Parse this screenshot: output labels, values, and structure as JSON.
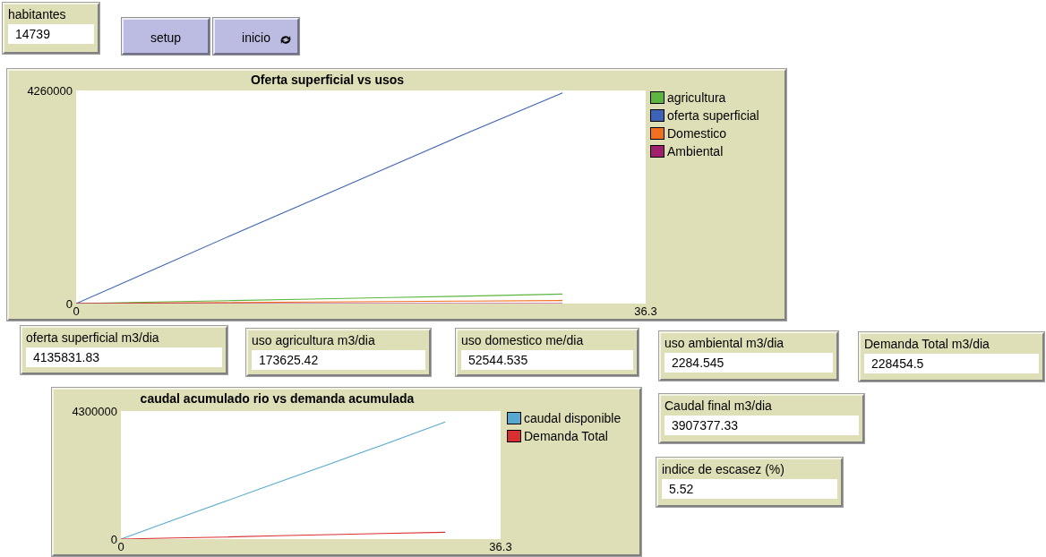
{
  "habitantes": {
    "label": "habitantes",
    "value": "14739"
  },
  "buttons": [
    {
      "label": "setup",
      "kind": "once"
    },
    {
      "label": "inicio",
      "kind": "forever"
    }
  ],
  "plots": [
    {
      "chart_data": {
        "type": "line",
        "title": "Oferta superficial vs usos",
        "x": [
          0,
          5,
          10,
          15,
          20,
          25,
          31
        ],
        "xlim": [
          0,
          36.3
        ],
        "ylim": [
          0,
          4260000
        ],
        "xticks": [
          {
            "value": 0,
            "label": "0"
          },
          36.3
        ],
        "yticks": [
          {
            "value": 0,
            "label": "0"
          },
          4260000
        ],
        "series": [
          {
            "name": "agricultura",
            "color": "#5cb53f",
            "values": [
              0,
              30000,
              60000,
              90000,
              120000,
              150000,
              190000
            ]
          },
          {
            "name": "oferta superficial",
            "color": "#3c63b5",
            "values": [
              0,
              690000,
              1380000,
              2060000,
              2740000,
              3420000,
              4210000
            ]
          },
          {
            "name": "Domestico",
            "color": "#f07020",
            "values": [
              0,
              10000,
              20000,
              30000,
              40000,
              50000,
              60000
            ]
          },
          {
            "name": "Ambiental",
            "color": "#a0206e",
            "values": [
              0,
              0,
              0,
              0,
              0,
              0,
              0
            ]
          }
        ]
      }
    },
    {
      "chart_data": {
        "type": "line",
        "title": "caudal acumulado rio vs demanda acumulada",
        "x": [
          0,
          5,
          10,
          15,
          20,
          25,
          31
        ],
        "xlim": [
          0,
          36.3
        ],
        "ylim": [
          0,
          4300000
        ],
        "xticks": [
          {
            "value": 0,
            "label": "0"
          },
          36.3
        ],
        "yticks": [
          {
            "value": 0,
            "label": "0"
          },
          4300000
        ],
        "series": [
          {
            "name": "caudal disponible",
            "color": "#56a8d0",
            "values": [
              0,
              640000,
              1270000,
              1900000,
              2530000,
              3160000,
              3930000
            ]
          },
          {
            "name": "Demanda Total",
            "color": "#d83030",
            "values": [
              0,
              40000,
              70000,
              110000,
              150000,
              190000,
              230000
            ]
          }
        ]
      }
    }
  ],
  "monitors": [
    {
      "label": "oferta superficial m3/dia",
      "value": "4135831.83"
    },
    {
      "label": "uso agricultura m3/dia",
      "value": "173625.42"
    },
    {
      "label": "uso domestico me/dia",
      "value": "52544.535"
    },
    {
      "label": "uso ambiental m3/dia",
      "value": "2284.545"
    },
    {
      "label": "Demanda Total m3/dia",
      "value": "228454.5"
    },
    {
      "label": "Caudal final m3/dia",
      "value": "3907377.33"
    },
    {
      "label": "indice de escasez (%)",
      "value": "5.52"
    }
  ]
}
